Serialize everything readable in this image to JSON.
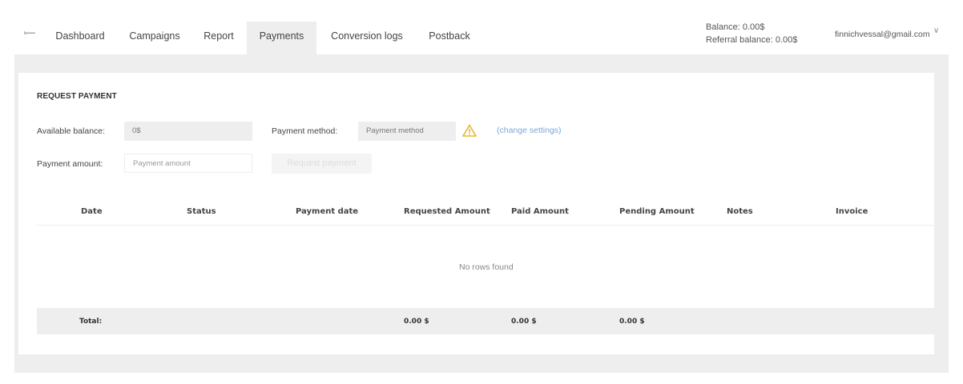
{
  "header": {
    "logo_text": "lo•••••",
    "nav": [
      {
        "label": "Dashboard"
      },
      {
        "label": "Campaigns"
      },
      {
        "label": "Report"
      },
      {
        "label": "Payments"
      },
      {
        "label": "Conversion logs"
      },
      {
        "label": "Postback"
      }
    ],
    "active_nav": "Payments",
    "balance": "Balance: 0.00$",
    "referral_balance": "Referral balance: 0.00$",
    "user_email": "finnichvessal@gmail.com"
  },
  "request_payment": {
    "title": "REQUEST PAYMENT",
    "available_balance_label": "Available balance:",
    "available_balance_value": "0$",
    "payment_method_label": "Payment method:",
    "payment_method_placeholder": "Payment method",
    "change_settings_link": "(change settings)",
    "payment_amount_label": "Payment amount:",
    "payment_amount_placeholder": "Payment amount",
    "request_button": "Request payment"
  },
  "table": {
    "columns": [
      "Date",
      "Status",
      "Payment date",
      "Requested Amount",
      "Paid Amount",
      "Pending Amount",
      "Notes",
      "Invoice"
    ],
    "empty_message": "No rows found",
    "total_label": "Total:",
    "total_requested": "0.00 $",
    "total_paid": "0.00 $",
    "total_pending": "0.00 $"
  },
  "colors": {
    "accent_link": "#7aa9d6",
    "warning": "#e8b62c",
    "active_tab_bg": "#eeeeee"
  }
}
